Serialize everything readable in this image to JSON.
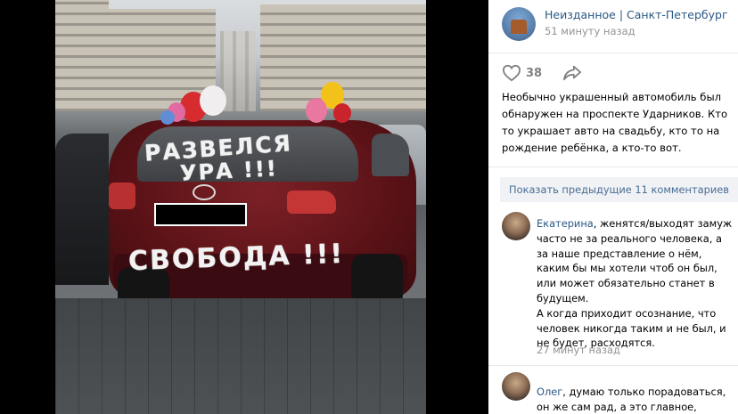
{
  "post": {
    "author": "Неизданное | Санкт-Петербург",
    "time": "51 минуту назад",
    "likes": "38",
    "text": "Необычно украшенный автомобиль был обнаружен на проспекте Ударников. Кто то украшает авто на свадьбу, кто то на рождение ребёнка, а кто-то вот."
  },
  "photo": {
    "text_line1": "РАЗВЕЛСЯ",
    "text_line2": "УРА !!!",
    "text_line3": "СВОБОДА !!!"
  },
  "comments": {
    "show_previous": "Показать предыдущие 11 комментариев",
    "items": [
      {
        "author": "Екатерина",
        "text": ", женятся/выходят замуж часто не за реального человека, а за наше представление о нём, каким бы мы хотели чтоб он был, или может обязательно станет в будущем.",
        "text2": "А когда приходит осознание, что человек никогда таким и не был, и не будет, расходятся.",
        "time": "27 минут назад"
      },
      {
        "author": "Олег",
        "text": ", думаю только порадоваться, он же сам рад, а это главное, найдут"
      }
    ]
  },
  "icons": {
    "like": "heart-icon",
    "share": "share-arrow-icon"
  },
  "colors": {
    "link": "#2a5885",
    "muted": "#939393",
    "button_bg": "#f0f2f5"
  }
}
